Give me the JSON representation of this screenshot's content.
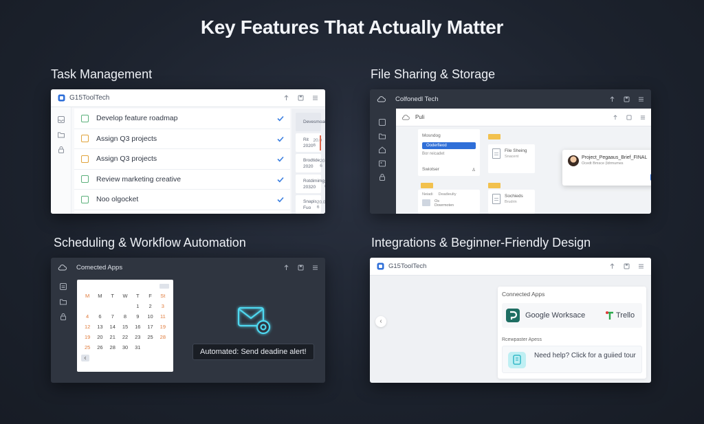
{
  "page": {
    "title": "Key Features That Actually Matter"
  },
  "sections": {
    "task": {
      "title": "Task Management"
    },
    "file": {
      "title": "File Sharing & Storage"
    },
    "schedule": {
      "title": "Scheduling & Workflow Automation"
    },
    "integrations": {
      "title": "Integrations & Beginner-Friendly Design"
    }
  },
  "task_panel": {
    "brand": "G15ToolTech",
    "tasks": [
      {
        "label": "Develop feature roadmap",
        "box": "green"
      },
      {
        "label": "Assign Q3 projects",
        "box": "orange"
      },
      {
        "label": "Assign Q3 projects",
        "box": "orange"
      },
      {
        "label": "Review marketing creative",
        "box": "green"
      },
      {
        "label": "Noo olgocket",
        "box": "green"
      }
    ],
    "side_items": [
      {
        "title": "Devesmoaily",
        "num": "0.0"
      },
      {
        "title": "Rit",
        "sub": "2020",
        "num": "20.0 6"
      },
      {
        "title": "Brodtide",
        "sub": "2020",
        "num": "20.0 6"
      },
      {
        "title": "Rotdimimg",
        "sub": "20320",
        "num": "20.0 6"
      },
      {
        "title": "Snapis",
        "sub": "Fuo",
        "num": "20.0 6"
      }
    ]
  },
  "file_panel": {
    "brand": "Colfonedl Tech",
    "inner_label": "Puli",
    "list_top": "Mosndog",
    "list_selected": "Ooderfieod",
    "list_sub": "Bor reicadet",
    "switch": "Swiotser",
    "file1": "File Sheing",
    "file1_sub": "Snacent",
    "file2": "Sochieds",
    "file2_sub": "Brudrin",
    "card3_a": "Neiadi",
    "card3_b": "Deadieulty",
    "card3_c": "Os",
    "card3_d": "Dowrmoten",
    "popup_title": "Project_Pegaaus_Brief_FINAL",
    "popup_sub": "Ocedt Bmsce (ldrmumes"
  },
  "schedule_panel": {
    "brand": "Comected Apps",
    "weekdays": [
      "M",
      "M",
      "T",
      "W",
      "T",
      "F",
      "St"
    ],
    "days": [
      "",
      "",
      "",
      "",
      "1",
      "2",
      "3",
      "4",
      "6",
      "7",
      "8",
      "9",
      "10",
      "11",
      "12",
      "13",
      "14",
      "15",
      "16",
      "17",
      "19",
      "19",
      "20",
      "21",
      "22",
      "23",
      "25",
      "28",
      "25",
      "26",
      "28",
      "30",
      "31",
      "",
      ""
    ],
    "toast": "Automated: Send deadine alert!"
  },
  "integrations_panel": {
    "brand": "G15ToolTech",
    "connected_header": "Connected Apps",
    "app1": "Google Worksace",
    "app2": "Trello",
    "recommended_header": "Rcewpaster Apess",
    "help": "Need help? Click for a guiied tour"
  },
  "colors": {
    "accent_blue": "#2f6fd8",
    "check_green": "#5bb07a",
    "task_orange": "#e0a33a",
    "glow_cyan": "#4fd8f0",
    "weekend_orange": "#e07a3a"
  },
  "icons": [
    "upload-icon",
    "save-icon",
    "menu-icon",
    "cloud-icon",
    "check-icon",
    "mail-gear-icon",
    "chevron-left-icon",
    "google-workspace-icon",
    "trello-icon",
    "help-icon"
  ]
}
